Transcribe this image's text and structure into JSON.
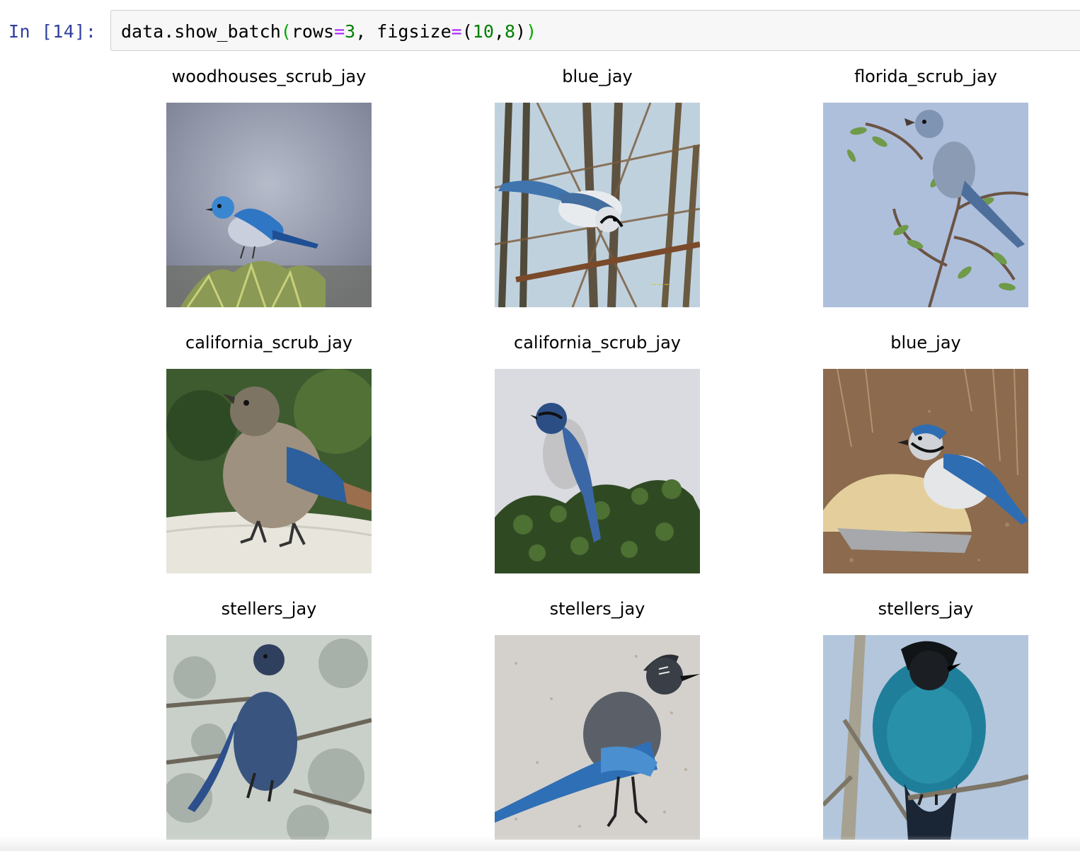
{
  "cell": {
    "prompt": "In [14]:",
    "code": {
      "obj": "data.show_batch",
      "open": "(",
      "arg1_name": "rows",
      "eq1": "=",
      "arg1_val": "3",
      "sep": ", ",
      "arg2_name": "figsize",
      "eq2": "=",
      "tuple_open": "(",
      "arg2_val_a": "10",
      "comma": ",",
      "arg2_val_b": "8",
      "tuple_close": ")",
      "close": ")"
    }
  },
  "batch": [
    {
      "label": "woodhouses_scrub_jay",
      "icon": "scrub-jay-photo"
    },
    {
      "label": "blue_jay",
      "icon": "blue-jay-in-branches-photo"
    },
    {
      "label": "florida_scrub_jay",
      "icon": "scrub-jay-on-branch-photo"
    },
    {
      "label": "california_scrub_jay",
      "icon": "scrub-jay-on-birdbath-photo"
    },
    {
      "label": "california_scrub_jay",
      "icon": "scrub-jay-on-bush-photo"
    },
    {
      "label": "blue_jay",
      "icon": "blue-jay-feeding-photo"
    },
    {
      "label": "stellers_jay",
      "icon": "stellers-jay-in-tree-photo"
    },
    {
      "label": "stellers_jay",
      "icon": "stellers-jay-on-ground-photo"
    },
    {
      "label": "stellers_jay",
      "icon": "stellers-jay-perched-photo"
    }
  ]
}
